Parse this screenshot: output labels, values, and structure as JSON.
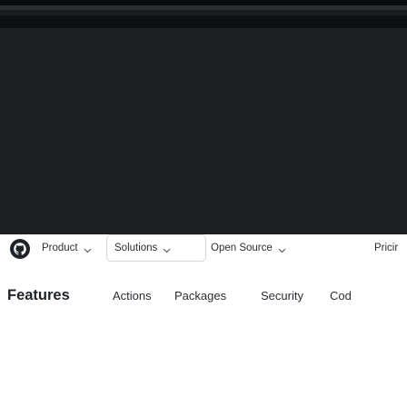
{
  "colors": {
    "background": "#ffffff",
    "top_band": "#1d1f21",
    "text": "#2b2f35",
    "heading": "#1f2328",
    "outline": "#d4d7db"
  },
  "logo": {
    "icon": "github-logo-icon"
  },
  "nav": {
    "items": [
      {
        "label": "Product",
        "has_dropdown": true
      },
      {
        "label": "Solutions",
        "has_dropdown": true
      },
      {
        "label": "Open Source",
        "has_dropdown": true
      },
      {
        "label": "Pricir",
        "has_dropdown": false
      }
    ]
  },
  "subnav": {
    "title": "Features",
    "items": [
      {
        "label": "Actions"
      },
      {
        "label": "Packages"
      },
      {
        "label": "Security"
      },
      {
        "label": "Cod"
      }
    ]
  }
}
